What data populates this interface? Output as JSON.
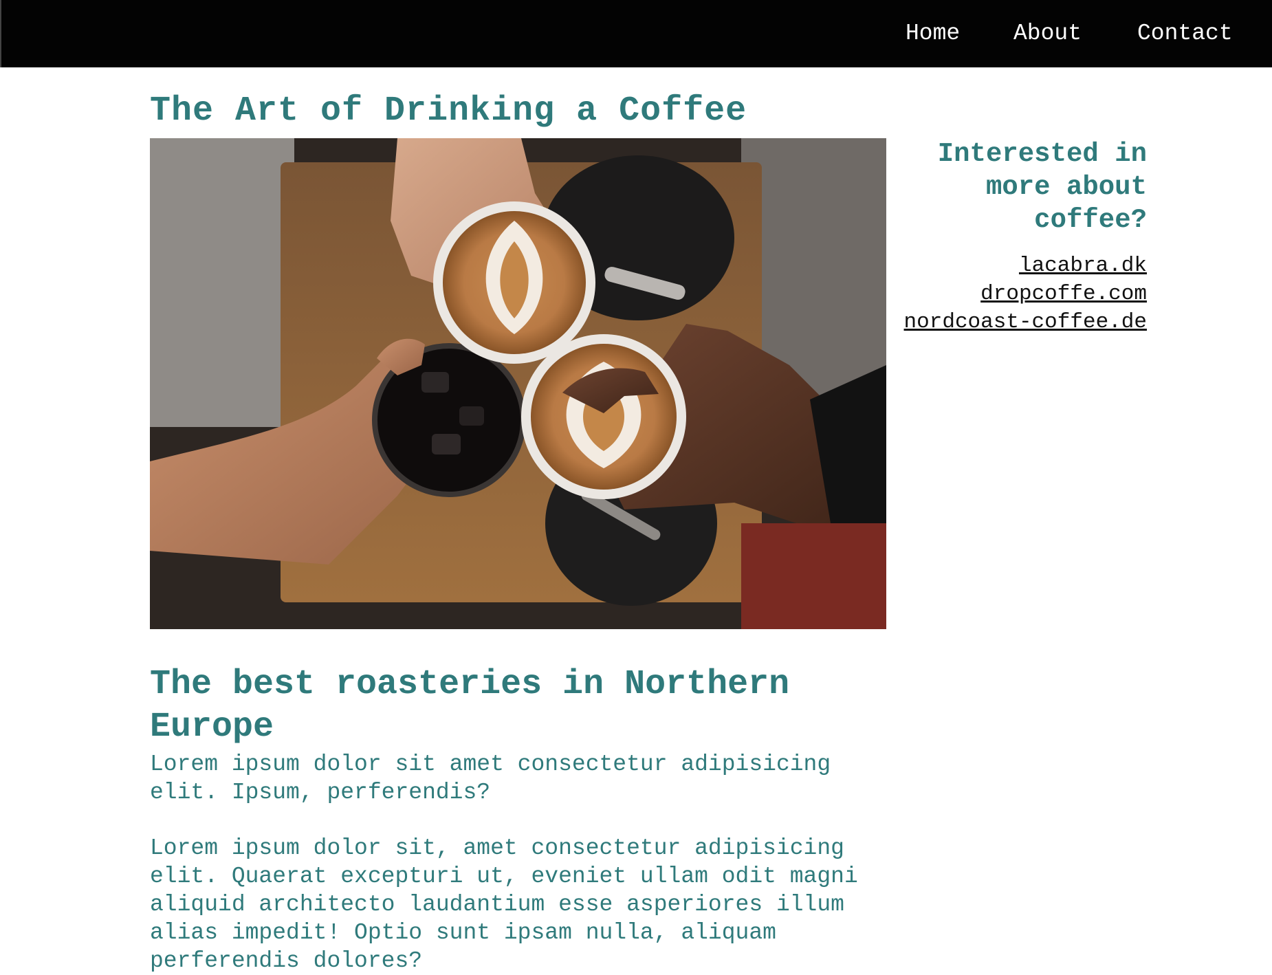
{
  "nav": {
    "items": [
      {
        "label": "Home"
      },
      {
        "label": "About"
      },
      {
        "label": "Contact"
      }
    ]
  },
  "main": {
    "title": "The Art of Drinking a Coffee",
    "section_title": "The best roasteries in Northern Europe",
    "paragraphs": [
      "Lorem ipsum dolor sit amet consectetur adipisicing elit. Ipsum, perferendis?",
      "Lorem ipsum dolor sit, amet consectetur adipisicing elit. Quaerat excepturi ut, eveniet ullam odit magni aliquid architecto laudantium esse asperiores illum alias impedit! Optio sunt ipsam nulla, aliquam perferendis dolores?"
    ]
  },
  "sidebar": {
    "heading": "Interested in more about coffee?",
    "links": [
      {
        "label": "lacabra.dk"
      },
      {
        "label": "dropcoffe.com"
      },
      {
        "label": "nordcoast-coffee.de"
      }
    ]
  },
  "colors": {
    "accent": "#2f7a7b",
    "nav_background": "#030303",
    "nav_text": "#ffffff",
    "link": "#111111"
  }
}
